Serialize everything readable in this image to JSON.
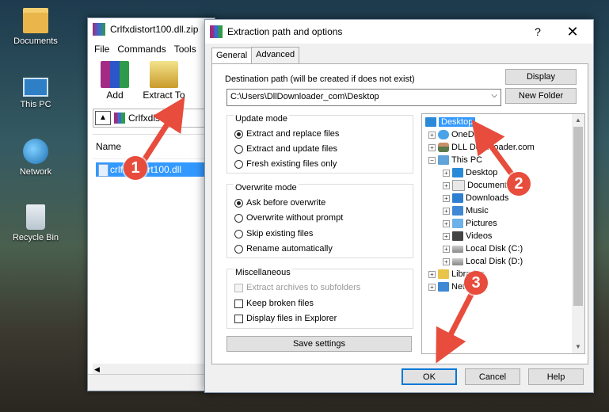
{
  "desktop": {
    "icons": [
      {
        "label": "Documents",
        "icon": "folder-icon"
      },
      {
        "label": "This PC",
        "icon": "computer-icon"
      },
      {
        "label": "Network",
        "icon": "network-icon"
      },
      {
        "label": "Recycle Bin",
        "icon": "recycle-bin-icon"
      }
    ]
  },
  "winrar": {
    "title": "Crlfxdistort100.dll.zip",
    "menu": [
      "File",
      "Commands",
      "Tools"
    ],
    "toolbar": {
      "add": "Add",
      "extract": "Extract To"
    },
    "path": "Crlfxdistort1",
    "list": {
      "header": "Name",
      "file": "crlfxdistort100.dll"
    }
  },
  "dialog": {
    "title": "Extraction path and options",
    "help": "?",
    "close": "✕",
    "tabs": [
      "General",
      "Advanced"
    ],
    "dest_label": "Destination path (will be created if does not exist)",
    "dest_value": "C:\\Users\\DllDownloader_com\\Desktop",
    "display_btn": "Display",
    "new_folder_btn": "New Folder",
    "update_mode": {
      "title": "Update mode",
      "options": [
        "Extract and replace files",
        "Extract and update files",
        "Fresh existing files only"
      ],
      "selected": 0
    },
    "overwrite_mode": {
      "title": "Overwrite mode",
      "options": [
        "Ask before overwrite",
        "Overwrite without prompt",
        "Skip existing files",
        "Rename automatically"
      ],
      "selected": 0
    },
    "misc": {
      "title": "Miscellaneous",
      "options": [
        "Extract archives to subfolders",
        "Keep broken files",
        "Display files in Explorer"
      ]
    },
    "save_btn": "Save settings",
    "tree": [
      {
        "label": "Desktop",
        "icon": "desktop-icon",
        "selected": true
      },
      {
        "label": "OneDrive",
        "icon": "cloud-icon"
      },
      {
        "label": "DLL Downloader.com",
        "icon": "user-icon"
      },
      {
        "label": "This PC",
        "icon": "computer-icon"
      },
      {
        "label": "Desktop",
        "icon": "desktop-icon"
      },
      {
        "label": "Documents",
        "icon": "documents-icon"
      },
      {
        "label": "Downloads",
        "icon": "downloads-icon"
      },
      {
        "label": "Music",
        "icon": "music-icon"
      },
      {
        "label": "Pictures",
        "icon": "pictures-icon"
      },
      {
        "label": "Videos",
        "icon": "videos-icon"
      },
      {
        "label": "Local Disk (C:)",
        "icon": "disk-icon"
      },
      {
        "label": "Local Disk (D:)",
        "icon": "disk-icon"
      },
      {
        "label": "Libraries",
        "icon": "library-icon"
      },
      {
        "label": "Network",
        "icon": "network-icon"
      }
    ],
    "ok_btn": "OK",
    "cancel_btn": "Cancel",
    "help_btn": "Help"
  },
  "annotations": [
    "1",
    "2",
    "3"
  ],
  "colors": {
    "accent": "#0078d7",
    "selection": "#3399ff",
    "marker": "#e74c3c"
  }
}
